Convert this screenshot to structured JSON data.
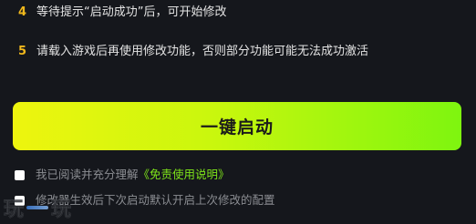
{
  "steps": [
    {
      "number": "4",
      "text": "等待提示“启动成功”后，可开始修改"
    },
    {
      "number": "5",
      "text": "请载入游戏后再使用修改功能，否则部分功能可能无法成功激活"
    }
  ],
  "launch_button": {
    "label": "一键启动"
  },
  "agreement": {
    "prefix": "我已阅读并充分理解",
    "link": "《免责使用说明》"
  },
  "remember_option": {
    "label": "修改器生效后下次启动默认开启上次修改的配置"
  },
  "watermark": {
    "left": "玩",
    "right": "玩"
  },
  "colors": {
    "background": "#15171c",
    "step_number": "#f1b81c",
    "button_gradient_start": "#eef50e",
    "button_gradient_end": "#7ef50f",
    "link": "#7ee41a"
  }
}
